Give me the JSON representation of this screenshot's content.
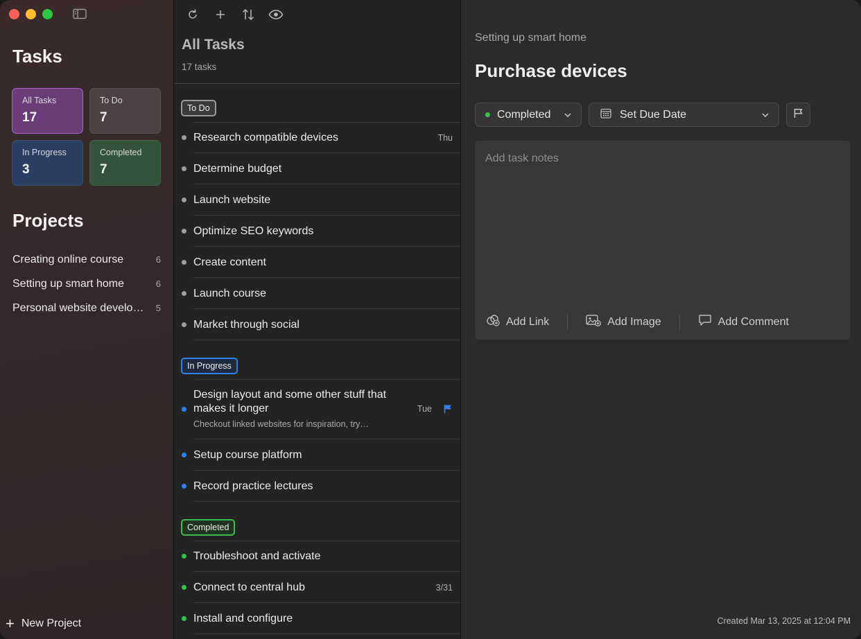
{
  "sidebar": {
    "title": "Tasks",
    "cards": {
      "all": {
        "label": "All Tasks",
        "count": "17"
      },
      "todo": {
        "label": "To Do",
        "count": "7"
      },
      "in_progress": {
        "label": "In Progress",
        "count": "3"
      },
      "completed": {
        "label": "Completed",
        "count": "7"
      }
    },
    "projects_title": "Projects",
    "projects": [
      {
        "name": "Creating online course",
        "count": "6"
      },
      {
        "name": "Setting up smart home",
        "count": "6"
      },
      {
        "name": "Personal website development",
        "count": "5"
      }
    ],
    "new_project": "New Project"
  },
  "list": {
    "title": "All Tasks",
    "count": "17 tasks",
    "groups": {
      "todo": {
        "label": "To Do",
        "items": [
          {
            "title": "Research compatible devices",
            "meta": "Thu"
          },
          {
            "title": "Determine budget"
          },
          {
            "title": "Launch website"
          },
          {
            "title": "Optimize SEO keywords"
          },
          {
            "title": "Create content"
          },
          {
            "title": "Launch course"
          },
          {
            "title": "Market through social"
          }
        ]
      },
      "in_progress": {
        "label": "In Progress",
        "items": [
          {
            "title": "Design layout and some other stuff that makes it longer",
            "subtitle": "Checkout linked websites for inspiration, try…",
            "meta": "Tue"
          },
          {
            "title": "Setup course platform"
          },
          {
            "title": "Record practice lectures"
          }
        ]
      },
      "completed": {
        "label": "Completed",
        "items": [
          {
            "title": "Troubleshoot and activate"
          },
          {
            "title": "Connect to central hub",
            "meta": "3/31"
          },
          {
            "title": "Install and configure"
          }
        ]
      }
    }
  },
  "detail": {
    "project": "Setting up smart home",
    "title": "Purchase devices",
    "status": "Completed",
    "due": "Set Due Date",
    "notes_placeholder": "Add task notes",
    "actions": {
      "link": "Add Link",
      "image": "Add Image",
      "comment": "Add Comment"
    },
    "created": "Created Mar 13, 2025 at 12:04 PM"
  },
  "colors": {
    "accent_purple": "#b25fd0",
    "blue": "#2f80ed",
    "green": "#35c24a"
  }
}
